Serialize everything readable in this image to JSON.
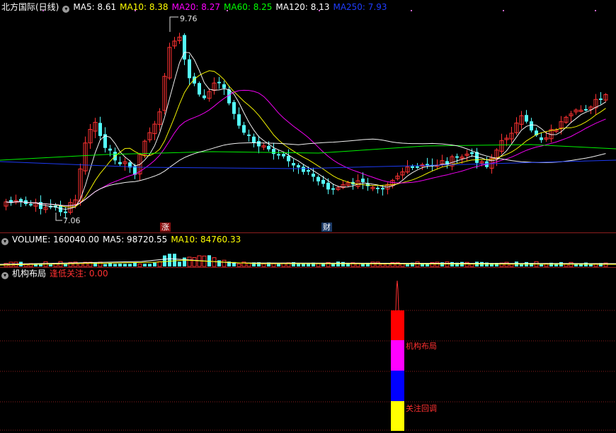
{
  "price_header": {
    "title": "北方国际(日线)",
    "indicators": [
      {
        "label": "MA5: 8.61",
        "color": "#ffffff"
      },
      {
        "label": "MA10: 8.38",
        "color": "#ffff00"
      },
      {
        "label": "MA20: 8.27",
        "color": "#ff00ff"
      },
      {
        "label": "MA60: 8.25",
        "color": "#00ff00"
      },
      {
        "label": "MA120: 8.13",
        "color": "#ffffff"
      },
      {
        "label": "MA250: 7.93",
        "color": "#1f3dff"
      }
    ]
  },
  "volume_header": {
    "indicators": [
      {
        "label": "VOLUME: 160040.00",
        "color": "#ffffff"
      },
      {
        "label": "MA5: 98720.55",
        "color": "#ffffff"
      },
      {
        "label": "MA10: 84760.33",
        "color": "#ffff00"
      }
    ]
  },
  "indicator_header": {
    "title": "机构布局",
    "value_label": "逢低关注: 0.00",
    "value_color": "#ff3030"
  },
  "price_annotations": {
    "high": "9.76",
    "low": "7.06"
  },
  "event_markers": {
    "up": "涨",
    "finance": "财"
  },
  "indicator_annotations": {
    "layout": "机构布局",
    "watch": "关注回调"
  },
  "colors": {
    "up": "#ff3232",
    "down": "#54fcfc",
    "grid": "#8c1e1e",
    "background": "#000000"
  },
  "chart_data": {
    "type": "candlestick",
    "y_low": 7.06,
    "y_high": 9.76,
    "ma_lines": [
      "MA5",
      "MA10",
      "MA20",
      "MA60",
      "MA120",
      "MA250"
    ],
    "indicator_bar": {
      "segments": [
        {
          "name": "关注回调",
          "color": "#ffff00"
        },
        {
          "name": "",
          "color": "#0000ff"
        },
        {
          "name": "机构布局",
          "color": "#ff00ff"
        },
        {
          "name": "",
          "color": "#ff0000"
        }
      ]
    }
  }
}
